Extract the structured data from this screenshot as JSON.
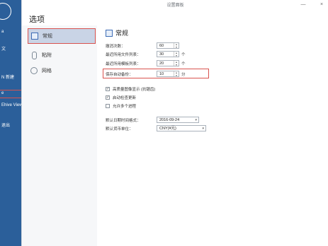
{
  "backdrop": {
    "sidebar_texts": [
      "",
      "a",
      "文",
      "",
      "N 新建",
      "",
      "e",
      "Ehive Viewer",
      "",
      "退出"
    ]
  },
  "dialog": {
    "window_title": "设置面板",
    "header": "选项",
    "nav": {
      "items": [
        {
          "label": "常规",
          "active": true,
          "icon": "document-icon"
        },
        {
          "label": "粘附",
          "active": false,
          "icon": "paperclip-icon"
        },
        {
          "label": "网格",
          "active": false,
          "icon": "globe-icon"
        }
      ]
    },
    "general": {
      "title": "常规",
      "fields": [
        {
          "label": "撤消次数：",
          "value": "60",
          "unit": ""
        },
        {
          "label": "最近所用文件列表：",
          "value": "30",
          "unit": "个"
        },
        {
          "label": "最近所用模板列表：",
          "value": "20",
          "unit": "个"
        },
        {
          "label": "保存自动备份：",
          "value": "10",
          "unit": "分"
        }
      ],
      "checkboxes": [
        {
          "label": "高质量图像显示 (抗锯齿)",
          "checked": true
        },
        {
          "label": "启动检查更新",
          "checked": true
        },
        {
          "label": "允许多个进程",
          "checked": false
        }
      ],
      "selects": [
        {
          "label": "默认日期时间格式：",
          "value": "2016-09-24"
        },
        {
          "label": "默认货币单位：",
          "value": "CNY(¥元)"
        }
      ]
    },
    "controls": {
      "minimize": "—",
      "close": "×"
    }
  }
}
